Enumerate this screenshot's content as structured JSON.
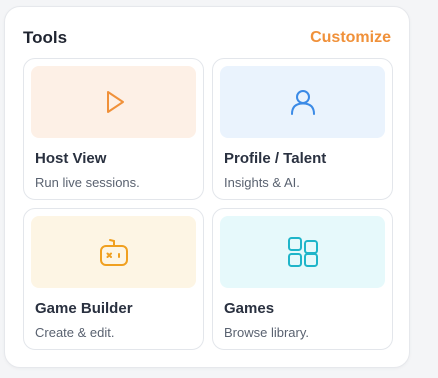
{
  "panel": {
    "title": "Tools",
    "customize_label": "Customize"
  },
  "cards": [
    {
      "title": "Host View",
      "subtitle": "Run live sessions.",
      "icon": "play-icon",
      "tint": "#fdf0e6",
      "icon_color": "#f0913a"
    },
    {
      "title": "Profile / Talent",
      "subtitle": "Insights & AI.",
      "icon": "user-icon",
      "tint": "#eaf3fd",
      "icon_color": "#3b8ae6"
    },
    {
      "title": "Game Builder",
      "subtitle": "Create & edit.",
      "icon": "robot-icon",
      "tint": "#fdf5e4",
      "icon_color": "#f0a020"
    },
    {
      "title": "Games",
      "subtitle": "Browse library.",
      "icon": "grid-icon",
      "tint": "#e6f9fb",
      "icon_color": "#1fb5c9"
    }
  ]
}
